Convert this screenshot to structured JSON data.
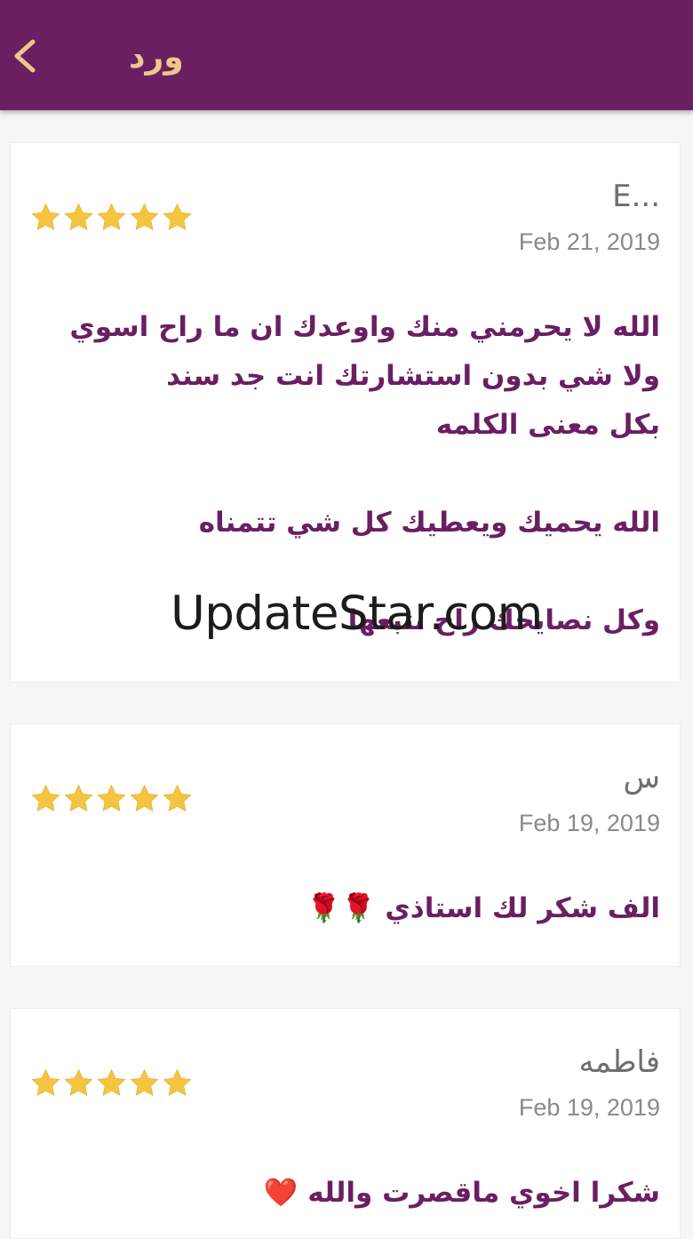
{
  "header": {
    "title": "ورد",
    "back_icon": "chevron-left-icon"
  },
  "colors": {
    "appbar": "#6a1f62",
    "title": "#f1c68a",
    "star": "#f5c542",
    "review_text": "#6a1f62"
  },
  "reviews": [
    {
      "reviewer": "E...",
      "date": "Feb 21, 2019",
      "rating": 5,
      "lines": [
        "الله لا يحرمني منك واوعدك ان ما راح اسوي",
        "ولا شي بدون استشارتك انت جد سند",
        "بكل معنى الكلمه",
        "",
        "الله يحميك ويعطيك كل شي تتمناه",
        "",
        "وكل نصايحك راح نتبعها"
      ]
    },
    {
      "reviewer": "س",
      "date": "Feb 19, 2019",
      "rating": 5,
      "lines": [
        "الف شكر لك استاذي 🌹🌹"
      ]
    },
    {
      "reviewer": "فاطمه",
      "date": "Feb 19, 2019",
      "rating": 5,
      "lines": [
        "شكرا اخوي ماقصرت والله ❤️"
      ]
    }
  ],
  "watermark": "UpdateStar.com"
}
